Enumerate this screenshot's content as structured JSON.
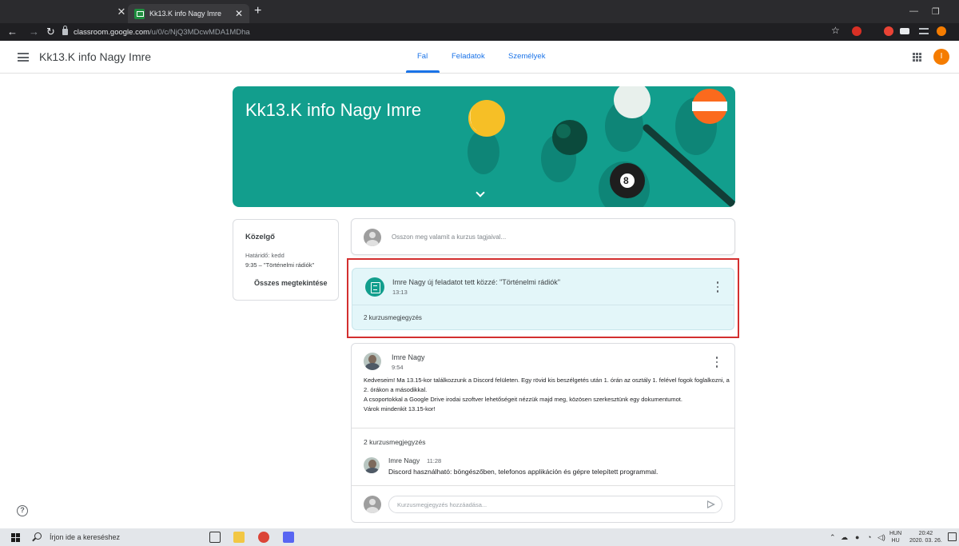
{
  "browser": {
    "tab_title": "Kk13.K info Nagy Imre",
    "url_host": "classroom.google.com",
    "url_path": "/u/0/c/NjQ3MDcwMDA1MDha"
  },
  "header": {
    "title": "Kk13.K info Nagy Imre",
    "tabs": [
      {
        "label": "Fal"
      },
      {
        "label": "Feladatok"
      },
      {
        "label": "Személyek"
      }
    ],
    "account_initial": "I"
  },
  "banner": {
    "title": "Kk13.K info Nagy Imre",
    "ball_number": "8"
  },
  "upcoming": {
    "title": "Közelgő",
    "due": "Határidő: kedd",
    "item": "9:35 – \"Történelmi rádiók\"",
    "view_all": "Összes megtekintése"
  },
  "share_box": {
    "placeholder": "Osszon meg valamit a kurzus tagjaival..."
  },
  "assignment": {
    "title": "Imre Nagy új feladatot tett közzé: \"Történelmi rádiók\"",
    "time": "13:13",
    "comments": "2 kurzusmegjegyzés"
  },
  "post": {
    "author": "Imre Nagy",
    "time": "9:54",
    "body": [
      "Kedveseim! Ma 13.15-kor találkozzunk a Discord felületen. Egy rövid kis beszélgetés után 1. órán az osztály 1. felével fogok foglalkozni, a 2. órákon a másodikkal.",
      "A csoportokkal a Google Drive irodai szoftver lehetőségeit nézzük majd meg, közösen szerkesztünk egy dokumentumot.",
      "Várok mindenkit 13.15-kor!"
    ],
    "comment_count": "2 kurzusmegjegyzés",
    "comment": {
      "author": "Imre Nagy",
      "time": "11:28",
      "text": "Discord használható: böngészőben, telefonos applikáción és gépre telepített programmal."
    },
    "comment_placeholder": "Kurzusmegjegyzés hozzáadása..."
  },
  "help": {
    "label": "?"
  },
  "taskbar": {
    "search_placeholder": "Írjon ide a kereséshez",
    "lang_top": "HUN",
    "lang_bottom": "HU",
    "time": "20:42",
    "date": "2020. 03. 26."
  },
  "colors": {
    "accent": "#1a73e8",
    "banner": "#129e8d",
    "highlight_frame": "#d32f2f",
    "assignment_bg": "#e3f6f9"
  }
}
